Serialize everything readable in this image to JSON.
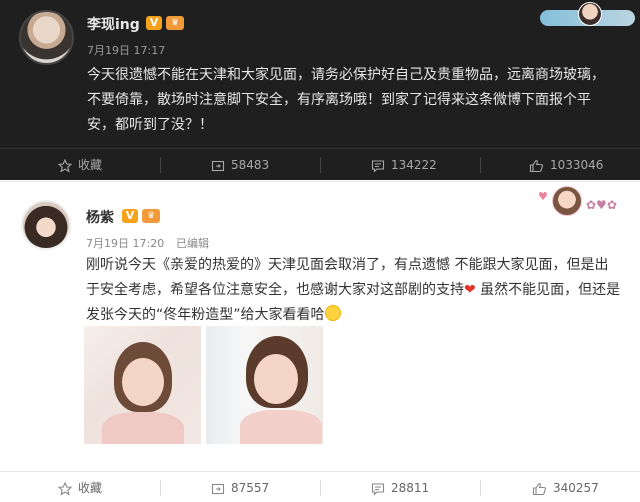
{
  "posts": [
    {
      "author": "李现ing",
      "verified_badge": "V",
      "time": "7月19日 17:17",
      "text": "今天很遗憾不能在天津和大家见面，请务必保护好自己及贵重物品，远离商场玻璃，不要倚靠，散场时注意脚下安全，有序离场哦！到家了记得来这条微博下面报个平安，都听到了没？！",
      "actions": {
        "favorite": "收藏",
        "repost": "58483",
        "comment": "134222",
        "like": "1033046"
      },
      "theme": {
        "background": "#1f1f1f",
        "text": "#e6e6e6"
      }
    },
    {
      "author": "杨紫",
      "verified_badge": "V",
      "time": "7月19日 17:20",
      "edited": "已编辑",
      "text_part1": "刚听说今天《亲爱的热爱的》天津见面会取消了，有点遗憾 不能跟大家见面，但是出于安全考虑，希望各位注意安全，也感谢大家对这部剧的支持",
      "text_part2": " 虽然不能见面，但还是发张今天的“佟年粉造型”给大家看看哈",
      "actions": {
        "favorite": "收藏",
        "repost": "87557",
        "comment": "28811",
        "like": "340257"
      },
      "theme": {
        "background": "#ffffff",
        "text": "#333333"
      }
    }
  ],
  "icons": {
    "favorite": "star-outline-icon",
    "repost": "repost-icon",
    "comment": "comment-icon",
    "like": "thumbs-up-icon"
  }
}
